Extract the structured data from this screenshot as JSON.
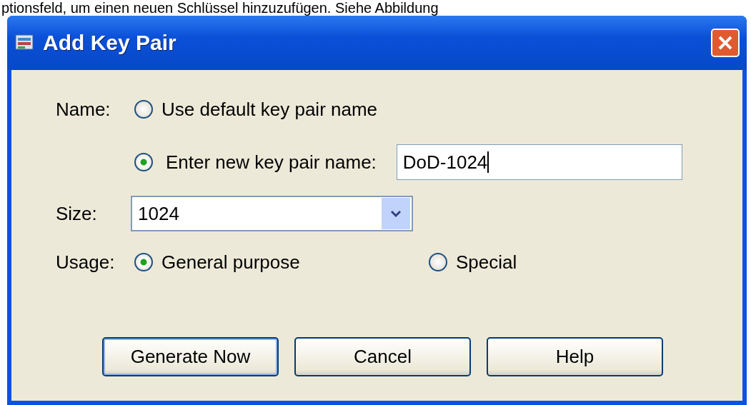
{
  "caption": "ptionsfeld, um einen neuen Schlüssel hinzuzufügen. Siehe Abbildung",
  "window": {
    "title": "Add Key Pair"
  },
  "name": {
    "label": "Name:",
    "options": [
      {
        "label": "Use default key pair name",
        "selected": false
      },
      {
        "label": "Enter new key pair name:",
        "selected": true
      }
    ],
    "value": "DoD-1024"
  },
  "size": {
    "label": "Size:",
    "value": "1024"
  },
  "usage": {
    "label": "Usage:",
    "options": [
      {
        "label": "General purpose",
        "selected": true
      },
      {
        "label": "Special",
        "selected": false
      }
    ]
  },
  "buttons": [
    {
      "label": "Generate Now",
      "default": true
    },
    {
      "label": "Cancel",
      "default": false
    },
    {
      "label": "Help",
      "default": false
    }
  ]
}
